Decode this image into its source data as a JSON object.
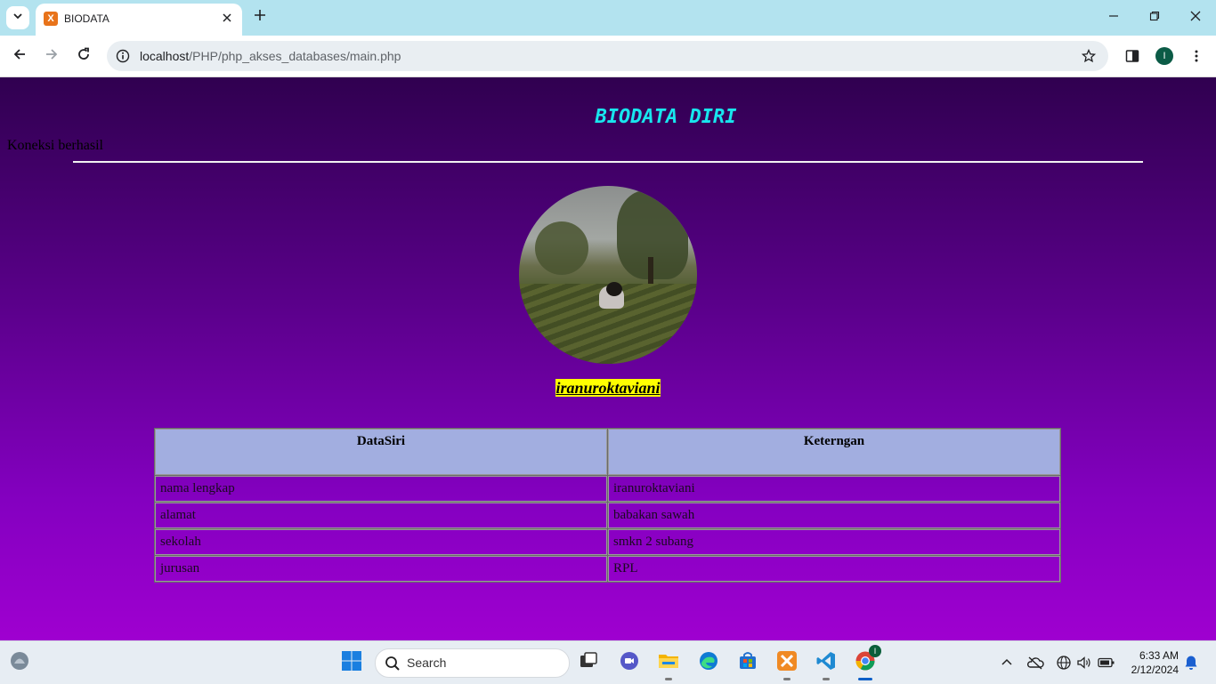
{
  "browser": {
    "tab_title": "BIODATA",
    "favicon_letter": "X",
    "url_host": "localhost",
    "url_path": "/PHP/php_akses_databases/main.php",
    "profile_initial": "I"
  },
  "page": {
    "title": "BIODATA DIRI",
    "status": "Koneksi berhasil",
    "name": "iranuroktaviani",
    "table": {
      "headers": [
        "DataSiri",
        "Keterngan"
      ],
      "rows": [
        [
          "nama lengkap",
          "iranuroktaviani"
        ],
        [
          "alamat",
          "babakan sawah"
        ],
        [
          "sekolah",
          "smkn 2 subang"
        ],
        [
          "jurusan",
          "RPL"
        ]
      ]
    }
  },
  "taskbar": {
    "search_label": "Search",
    "time": "6:33 AM",
    "date": "2/12/2024",
    "chrome_badge": "I"
  },
  "colors": {
    "title": "#18e6ee",
    "name_highlight": "#ffff00",
    "table_header": "#a2aee0"
  }
}
